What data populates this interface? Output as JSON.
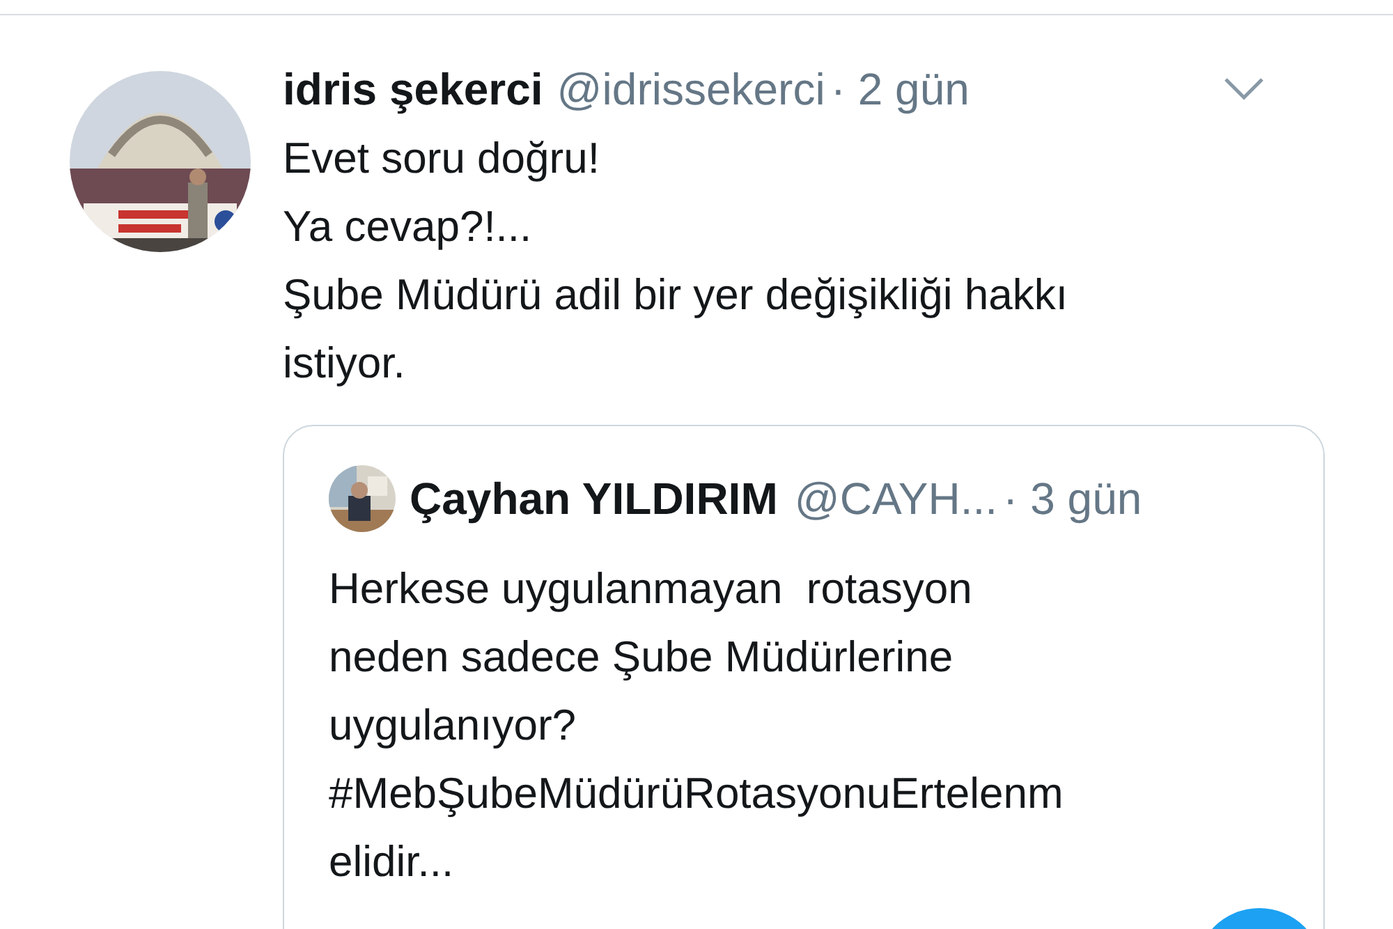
{
  "tweet": {
    "author_name": "idris şekerci",
    "handle": "@idrissekerci",
    "time": "· 2 gün",
    "avatar": {
      "kind": "picture"
    },
    "text_lines": [
      "Evet soru doğru!",
      "Ya cevap?!...",
      "Şube Müdürü adil bir yer değişikliği hakkı",
      "istiyor."
    ],
    "quoted_tweet": {
      "author_name": "Çayhan YILDIRIM",
      "handle": "@CAYH...",
      "time": "· 3 gün",
      "avatar": {
        "kind": "picture"
      },
      "text_lines": [
        "Herkese uygulanmayan  rotasyon",
        "neden sadece Şube Müdürlerine",
        "uygulanıyor?",
        "#MebŞubeMüdürüRotasyonuErtelenm",
        "elidir..."
      ]
    }
  }
}
